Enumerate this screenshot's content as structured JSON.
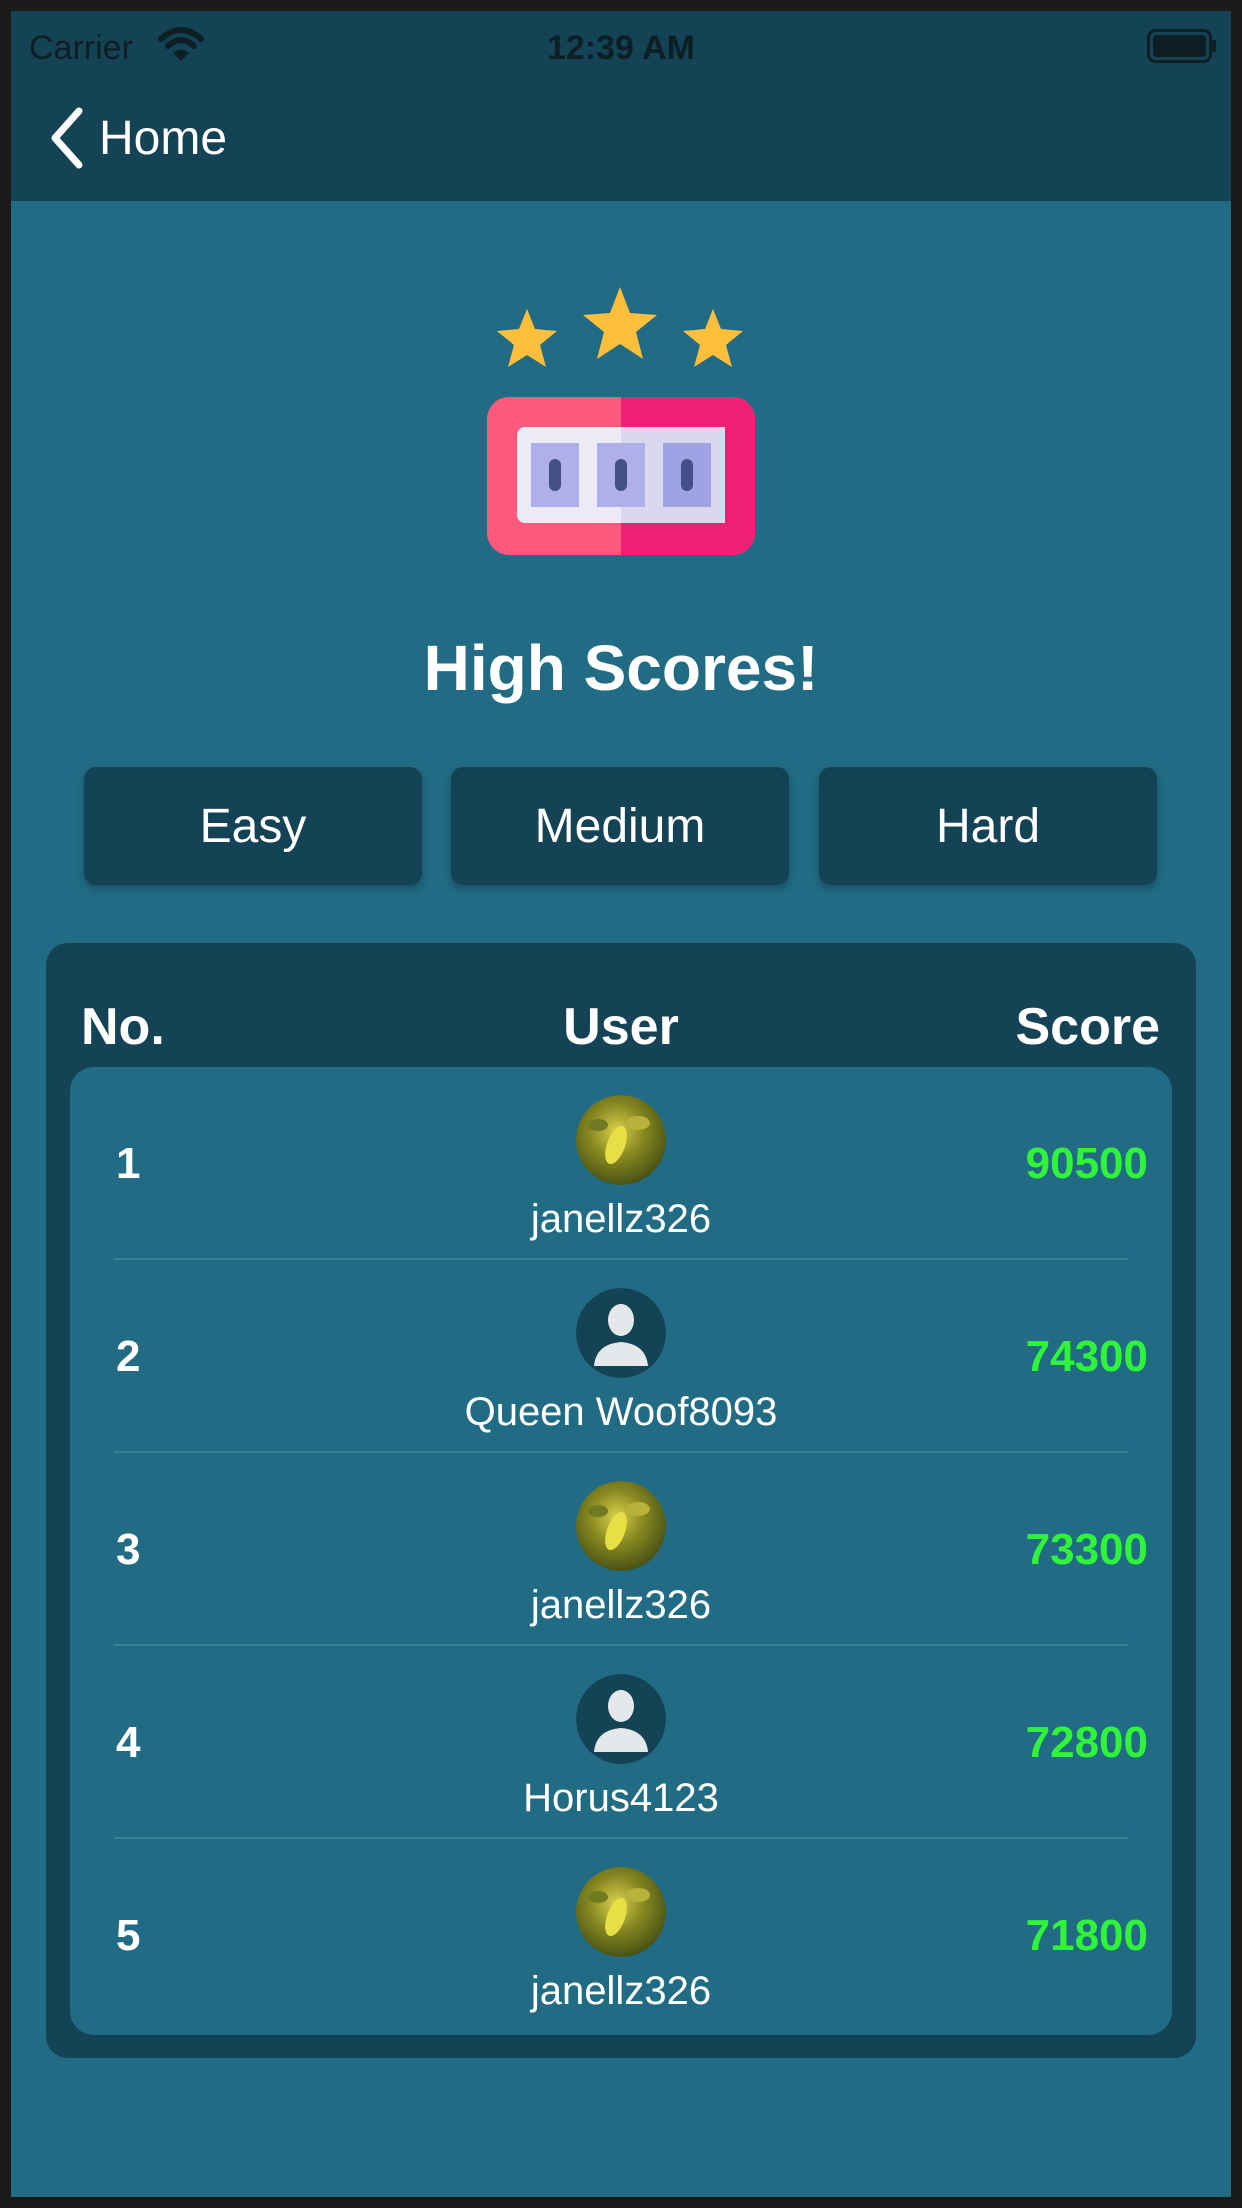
{
  "status_bar": {
    "carrier": "Carrier",
    "time": "12:39 AM",
    "wifi_icon": "wifi-icon",
    "battery_icon": "battery-full-icon"
  },
  "nav": {
    "back_label": "Home",
    "back_icon": "chevron-left-icon"
  },
  "hero": {
    "icon": "slot-machine-with-three-stars-icon",
    "title": "High Scores!"
  },
  "difficulty": {
    "easy": "Easy",
    "medium": "Medium",
    "hard": "Hard"
  },
  "leaderboard": {
    "headers": {
      "rank": "No.",
      "user": "User",
      "score": "Score"
    },
    "rows": [
      {
        "rank": "1",
        "user": "janellz326",
        "score": "90500",
        "avatar": "photo-avatar"
      },
      {
        "rank": "2",
        "user": "Queen Woof8093",
        "score": "74300",
        "avatar": "default-user-icon"
      },
      {
        "rank": "3",
        "user": "janellz326",
        "score": "73300",
        "avatar": "photo-avatar"
      },
      {
        "rank": "4",
        "user": "Horus4123",
        "score": "72800",
        "avatar": "default-user-icon"
      },
      {
        "rank": "5",
        "user": "janellz326",
        "score": "71800",
        "avatar": "photo-avatar"
      }
    ]
  },
  "colors": {
    "background": "#226b84",
    "bar": "#134355",
    "score_green": "#2ff43a"
  }
}
